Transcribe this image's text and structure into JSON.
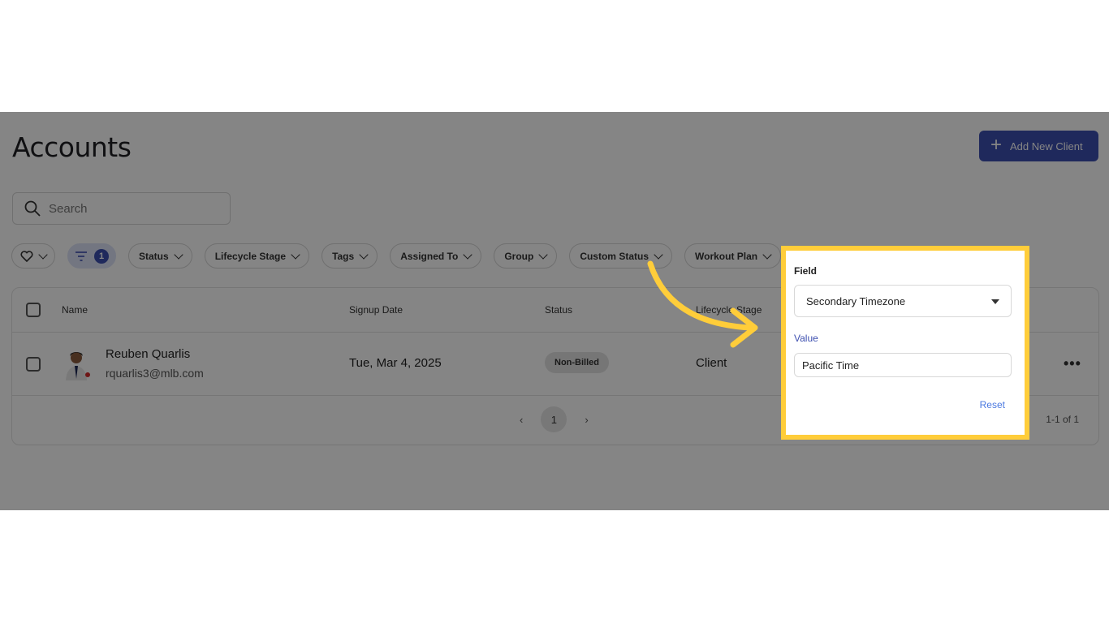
{
  "page": {
    "title": "Accounts",
    "add_button_label": "Add New Client"
  },
  "search": {
    "placeholder": "Search"
  },
  "filters": {
    "active_count": "1",
    "chips": [
      "Status",
      "Lifecycle Stage",
      "Tags",
      "Assigned To",
      "Group",
      "Custom Status",
      "Workout Plan"
    ]
  },
  "table": {
    "headers": {
      "name": "Name",
      "signup_date": "Signup Date",
      "status": "Status",
      "lifecycle_stage": "Lifecycle Stage"
    },
    "rows": [
      {
        "name": "Reuben Quarlis",
        "email": "rquarlis3@mlb.com",
        "signup_date": "Tue, Mar 4, 2025",
        "status": "Non-Billed",
        "lifecycle_stage": "Client"
      }
    ]
  },
  "pagination": {
    "current_page": "1",
    "range_text": "1-1 of 1"
  },
  "filter_popup": {
    "field_label": "Field",
    "field_value": "Secondary Timezone",
    "value_label": "Value",
    "value_value": "Pacific Time",
    "reset_label": "Reset"
  },
  "colors": {
    "accent": "#3d4fb0",
    "highlight": "#ffcd3a",
    "overlay": "rgba(0,0,0,0.48)"
  }
}
